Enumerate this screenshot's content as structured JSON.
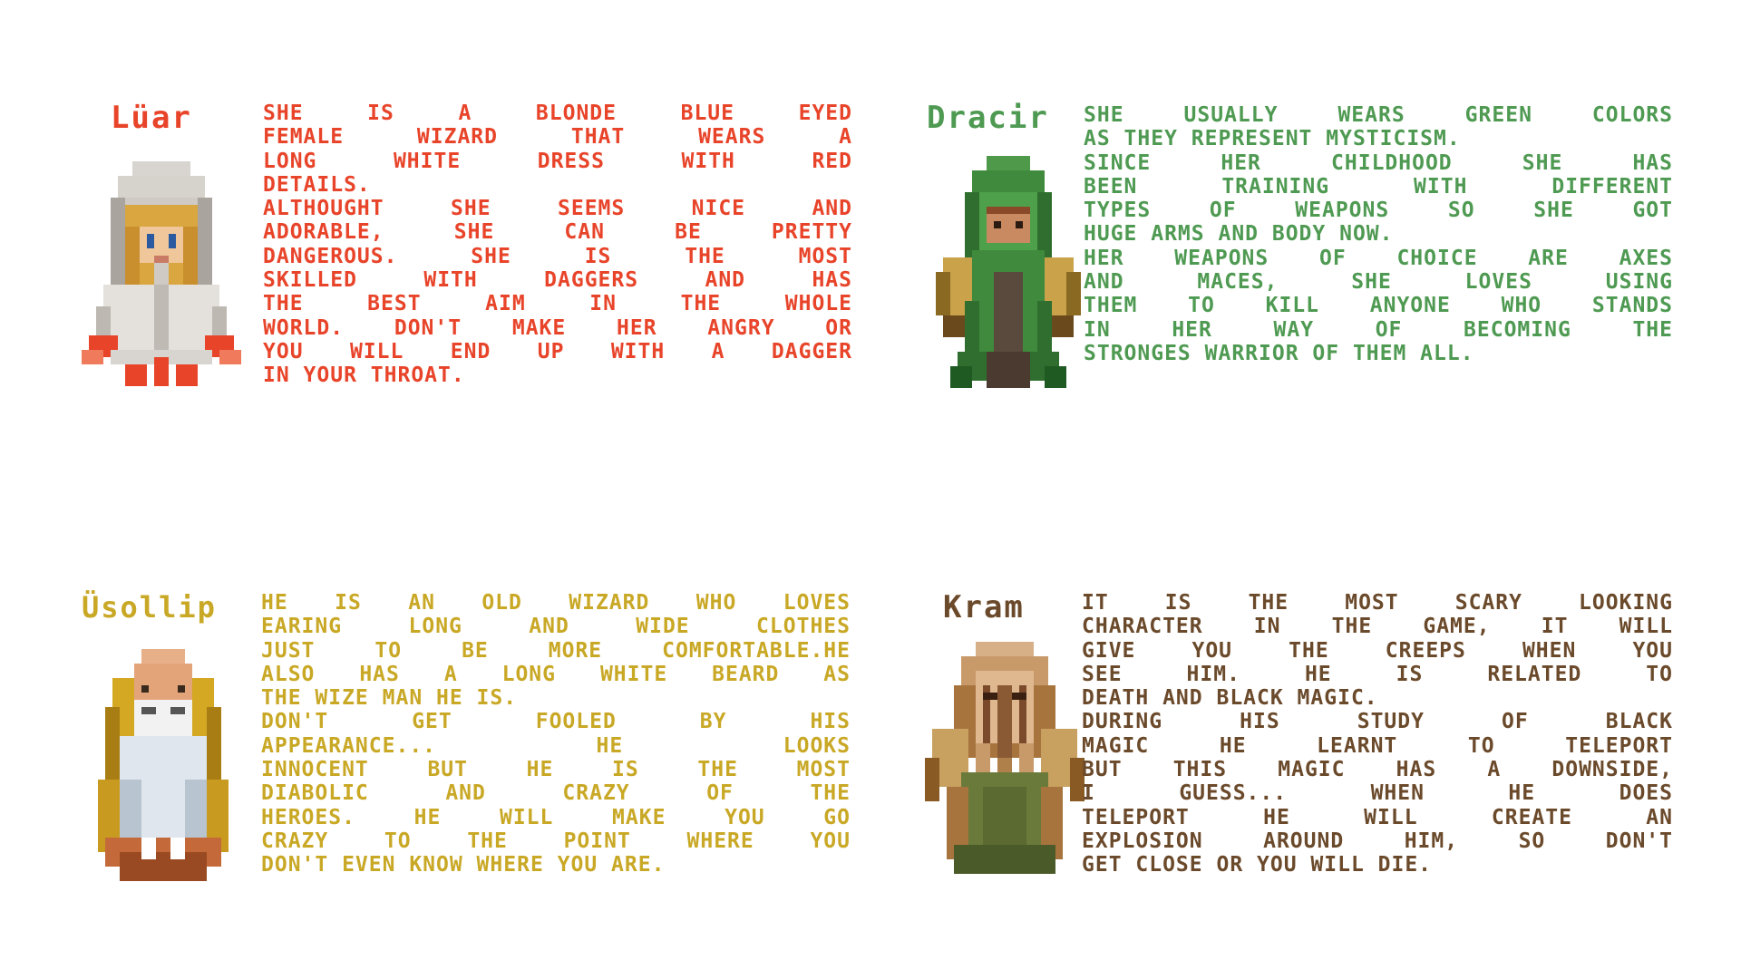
{
  "characters": [
    {
      "name": "Lüar",
      "color": "#e8442a",
      "portrait_icon": "white-hooded-wizard-sprite",
      "lines": [
        "SHE IS A BLONDE BLUE EYED",
        "FEMALE WIZARD THAT WEARS A",
        "LONG WHITE DRESS WITH RED",
        "DETAILS.",
        "ALTHOUGHT SHE SEEMS NICE AND",
        "ADORABLE, SHE CAN BE PRETTY",
        "DANGEROUS. SHE IS THE MOST",
        "SKILLED WITH DAGGERS AND HAS",
        "THE BEST AIM IN THE WHOLE",
        "WORLD. DON'T MAKE HER ANGRY OR",
        "YOU WILL END UP WITH A DAGGER",
        "IN YOUR THROAT."
      ]
    },
    {
      "name": "Dracir",
      "color": "#4f9a52",
      "portrait_icon": "green-hooded-warrior-sprite",
      "lines": [
        "SHE USUALLY WEARS GREEN COLORS",
        "AS THEY REPRESENT MYSTICISM.",
        "SINCE HER CHILDHOOD SHE HAS",
        "BEEN TRAINING WITH DIFFERENT",
        "TYPES OF WEAPONS SO SHE GOT",
        "HUGE ARMS AND BODY NOW.",
        "HER WEAPONS OF CHOICE ARE AXES",
        "AND MACES, SHE LOVES USING",
        "THEM TO KILL ANYONE WHO STANDS",
        "IN HER WAY OF BECOMING THE",
        "STRONGES WARRIOR OF THEM ALL."
      ]
    },
    {
      "name": "Üsollip",
      "color": "#c9a826",
      "portrait_icon": "old-bearded-wizard-sprite",
      "lines": [
        "HE IS AN OLD WIZARD WHO LOVES",
        "EARING LONG AND WIDE CLOTHES",
        "JUST TO BE MORE COMFORTABLE.HE",
        "ALSO HAS A LONG WHITE BEARD AS",
        "THE WIZE MAN HE IS.",
        "DON'T GET FOOLED BY HIS",
        "APPEARANCE... HE LOOKS",
        "INNOCENT BUT HE IS THE MOST",
        "DIABOLIC AND CRAZY OF THE",
        "HEROES. HE WILL MAKE YOU GO",
        "CRAZY TO THE POINT WHERE YOU",
        "DON'T EVEN KNOW WHERE YOU ARE."
      ]
    },
    {
      "name": "Kram",
      "color": "#6b4a2b",
      "portrait_icon": "tentacle-faced-creature-sprite",
      "lines": [
        "IT IS THE MOST SCARY LOOKING",
        "CHARACTER IN THE GAME, IT WILL",
        "GIVE YOU THE CREEPS WHEN YOU",
        "SEE HIM. HE IS RELATED TO",
        "DEATH AND BLACK MAGIC.",
        "DURING HIS STUDY OF BLACK",
        "MAGIC HE LEARNT TO TELEPORT",
        "BUT THIS MAGIC HAS A DOWNSIDE,",
        "I GUESS... WHEN HE DOES",
        "TELEPORT HE WILL CREATE AN",
        "EXPLOSION AROUND HIM, SO DON'T",
        "GET CLOSE OR YOU WILL DIE."
      ]
    }
  ]
}
